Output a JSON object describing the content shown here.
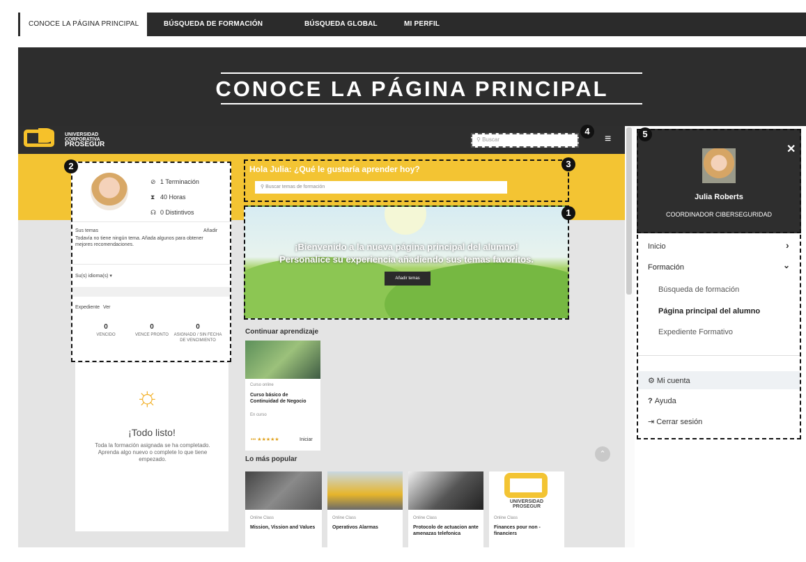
{
  "top_tabs": [
    "CONOCE LA PÁGINA PRINCIPAL",
    "BÚSQUEDA DE FORMACIÓN",
    "BÚSQUEDA GLOBAL",
    "MI PERFIL"
  ],
  "banner_title": "CONOCE LA PÁGINA PRINCIPAL",
  "logo": {
    "line1": "UNIVERSIDAD",
    "line2": "CORPORATIVA",
    "line3": "PROSEGUR"
  },
  "search_placeholder": "Buscar",
  "badges": [
    "1",
    "2",
    "3",
    "4",
    "5"
  ],
  "profile": {
    "stats": [
      "1 Terminación",
      "40 Horas",
      "0 Distintivos"
    ],
    "topics_label": "Sus temas",
    "topics_add": "Añadir",
    "topics_empty": "Todavía no tiene ningún tema. Añada algunos para obtener mejores recomendaciones.",
    "languages": "Su(s) idioma(s)",
    "record_label": "Expediente",
    "record_link": "Ver",
    "counts": [
      {
        "value": "0",
        "label": "VENCIDO"
      },
      {
        "value": "0",
        "label": "VENCE PRONTO"
      },
      {
        "value": "0",
        "label": "ASIGNADO / SIN FECHA DE VENCIMIENTO"
      }
    ]
  },
  "todo": {
    "title": "¡Todo listo!",
    "text": "Toda la formación asignada se ha completado. Aprenda algo nuevo o complete lo que tiene empezado."
  },
  "greeting": "Hola Julia: ¿Qué le gustaría aprender hoy?",
  "greeting_placeholder": "Buscar temas de formación",
  "hero": {
    "line1": "¡Bienvenido a la nueva página principal del alumno!",
    "line2": "Personalice su experiencia añadiendo sus temas favoritos.",
    "button": "Añadir temas"
  },
  "continue_label": "Continuar aprendizaje",
  "continue_course": {
    "type": "Curso online",
    "title": "Curso básico de Continuidad de Negocio",
    "status": "En curso",
    "action": "Iniciar"
  },
  "popular_label": "Lo más popular",
  "popular": [
    {
      "type": "Online Class",
      "title": "Mission, Vission and Values"
    },
    {
      "type": "Online Class",
      "title": "Operativos Alarmas"
    },
    {
      "type": "Online Class",
      "title": "Protocolo de actuacion ante amenazas telefonica"
    },
    {
      "type": "Online Class",
      "title": "Finances pour non - financiers"
    }
  ],
  "user": {
    "name": "Julia Roberts",
    "role": "COORDINADOR CIBERSEGURIDAD"
  },
  "menu": {
    "inicio": "Inicio",
    "formacion": "Formación",
    "sub": [
      "Búsqueda de formación",
      "Página principal del alumno",
      "Expediente Formativo"
    ],
    "account": "Mi cuenta",
    "help": "Ayuda",
    "logout": "Cerrar sesión"
  },
  "colors": {
    "accent": "#f3c433",
    "dark": "#2e2e2e"
  }
}
